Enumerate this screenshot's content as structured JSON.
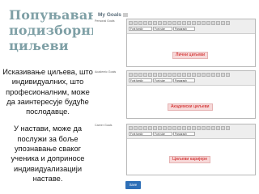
{
  "slide": {
    "title_lines": [
      "Попуњавање",
      "подизборника",
      "циљеви"
    ],
    "paragraph_1": "Исказивање циљева, што индивидуалних, што професионалним, може да заинтересује будуће послодавце.",
    "paragraph_2": "У настави, може да послужи за боље упознавање сваког ученика и доприносе индивидуализацији наставе."
  },
  "screen": {
    "header": "My Goals",
    "sections": [
      {
        "label": "Personal Goals",
        "note": "Лични циљеви",
        "font_family": "Font family",
        "font_size": "Font size",
        "format": "Paragraph"
      },
      {
        "label": "Academic Goals",
        "note": "Академски циљеви",
        "font_family": "Font family",
        "font_size": "Font size",
        "format": "Paragraph"
      },
      {
        "label": "Career Goals",
        "note": "Циљеви каријере",
        "font_family": "Font family",
        "font_size": "Font size",
        "format": "Paragraph"
      }
    ],
    "save_label": "Save"
  },
  "colors": {
    "title": "#7fa0a6",
    "note_bg": "#f7d8d8",
    "note_text": "#cc1515",
    "save_button": "#2e6fb7"
  }
}
